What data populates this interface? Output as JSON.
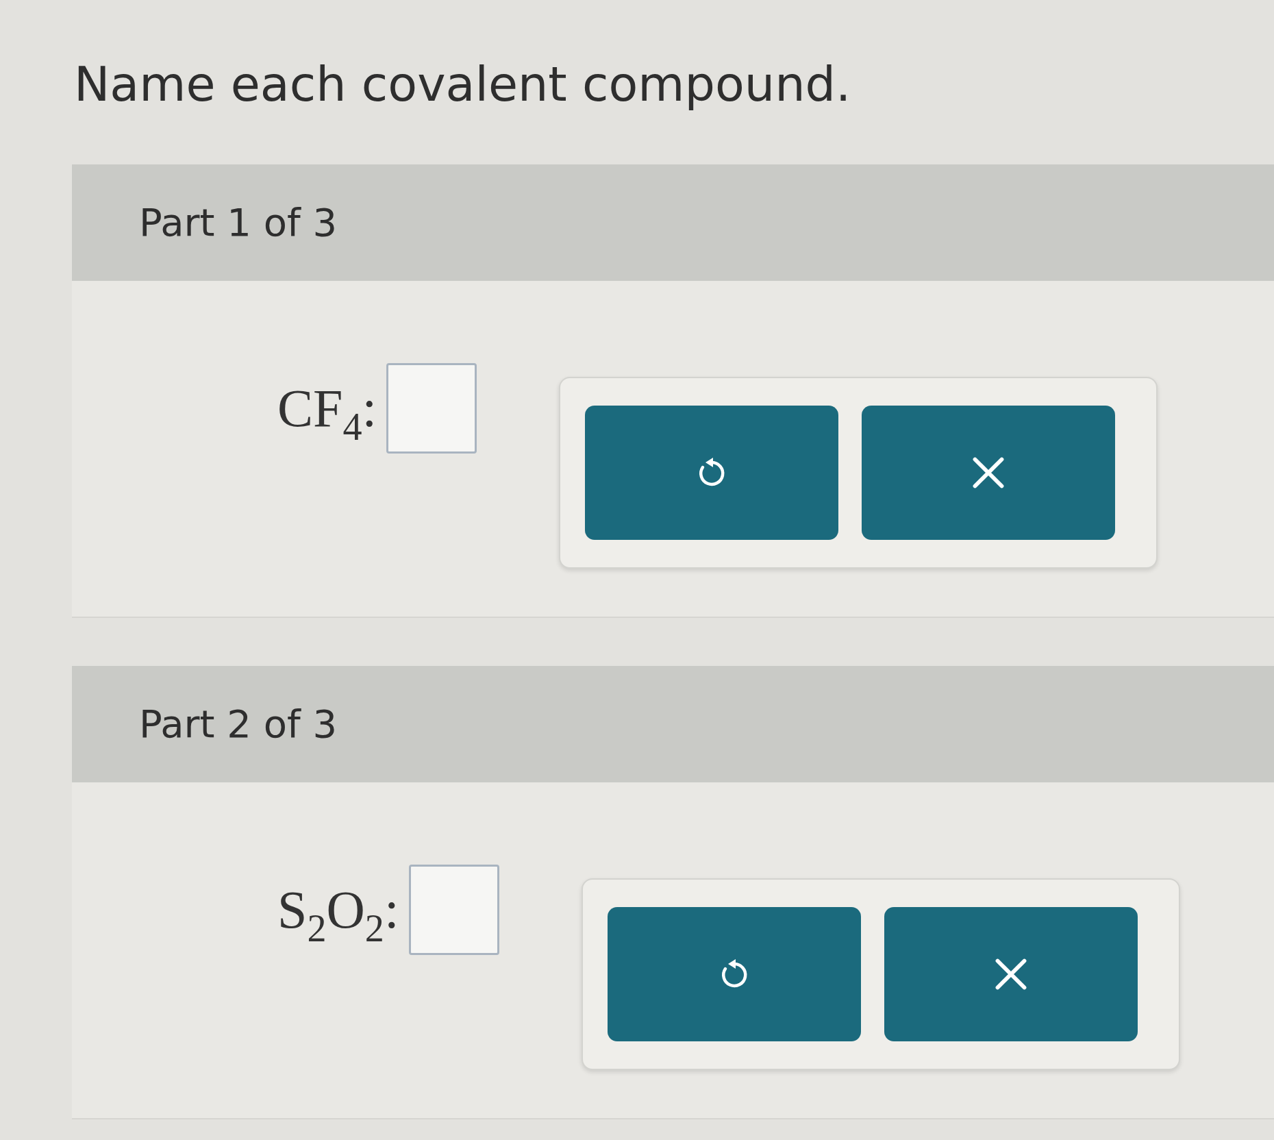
{
  "question": "Name each covalent compound.",
  "parts": [
    {
      "header": "Part 1 of 3",
      "formula": "CF$_{4}$:"
    },
    {
      "header": "Part 2 of 3",
      "formula": "S$_{2}$O$_{2}$:"
    }
  ]
}
